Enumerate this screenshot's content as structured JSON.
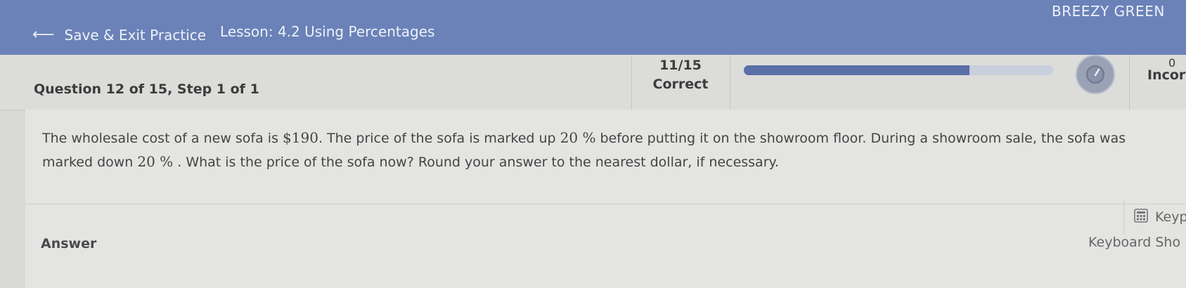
{
  "header": {
    "back_label": "Save & Exit Practice",
    "lesson": "Lesson: 4.2 Using Percentages",
    "user_name": "BREEZY GREEN"
  },
  "status": {
    "question_label": "Question 12 of 15,  Step 1 of 1",
    "score": "11/15",
    "score_label": "Correct",
    "progress_fraction": 0.73,
    "incorrect_count": "0",
    "incorrect_label": "Incor"
  },
  "problem": {
    "line1_a": "The wholesale cost of a new sofa is ",
    "price": "$190",
    "line1_b": ". The price of the sofa is marked up ",
    "markup": "20 %",
    "line1_c": "  before putting it on the showroom floor. During a showroom sale, the sofa was",
    "line2_a": "marked down ",
    "markdown": "20 %",
    "line2_b": " . What is the price of the sofa now? Round your answer to the nearest dollar, if necessary."
  },
  "answer": {
    "label": "Answer",
    "keypad_label": "Keyp",
    "shortcuts_label": "Keyboard Sho"
  },
  "colors": {
    "topbar": "#6a82b8",
    "progress_fill": "#5a6fa8"
  }
}
